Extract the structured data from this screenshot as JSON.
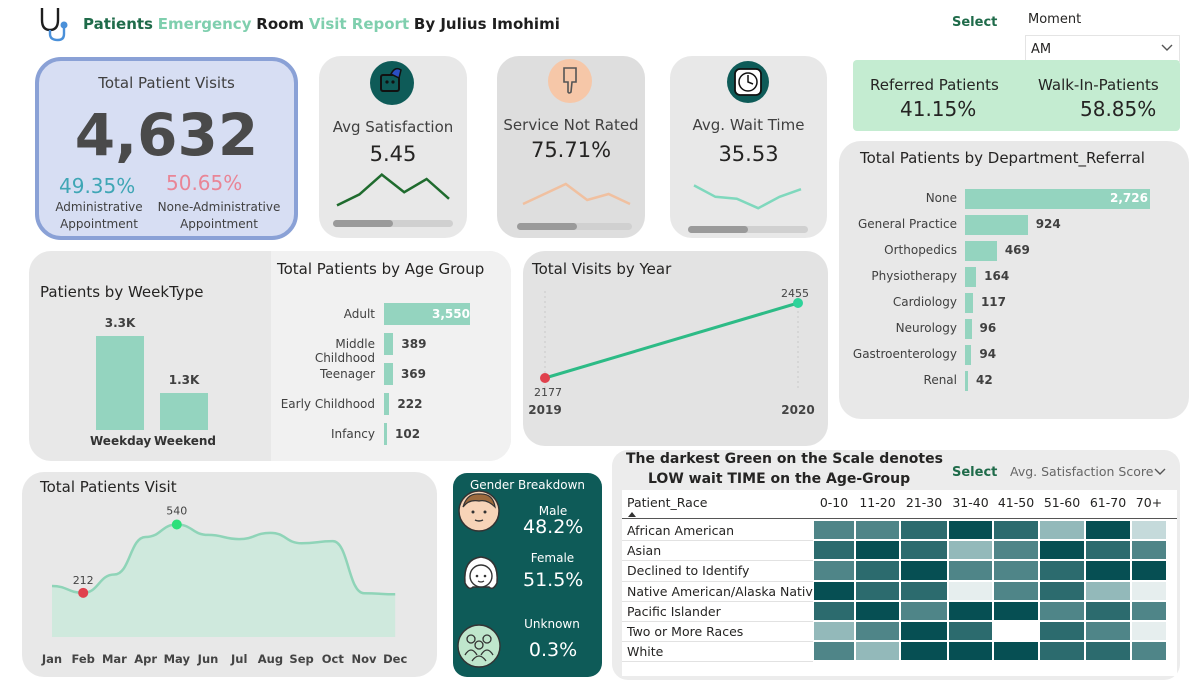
{
  "header": {
    "title_part1": "Patients",
    "title_part2": "Emergency",
    "title_part3": "Room",
    "title_part4": "Visit Report",
    "title_part5": "By Julius Imohimi",
    "select_label": "Select",
    "moment_label": "Moment",
    "moment_value": "AM"
  },
  "total_visits": {
    "title": "Total Patient Visits",
    "value": "4,632",
    "admin_pct": "49.35%",
    "admin_label_1": "Administrative",
    "admin_label_2": "Appointment",
    "nonadmin_pct": "50.65%",
    "nonadmin_label_1": "None-Administrative",
    "nonadmin_label_2": "Appointment"
  },
  "kpis": [
    {
      "title": "Avg Satisfaction",
      "value": "5.45",
      "icon": "satisfaction-icon",
      "trend": [
        0.15,
        0.4,
        0.85,
        0.45,
        0.75,
        0.3
      ],
      "color": "#1f6b2e",
      "scroll": 0.68
    },
    {
      "title": "Service Not Rated",
      "value": "75.71%",
      "icon": "thumb-icon",
      "trend": [
        0.2,
        0.45,
        0.7,
        0.3,
        0.45,
        0.2
      ],
      "color": "#f0c0a0",
      "scroll": 0.5
    },
    {
      "title": "Avg. Wait Time",
      "value": "35.53",
      "icon": "clock-icon",
      "trend": [
        0.7,
        0.4,
        0.35,
        0.1,
        0.4,
        0.6
      ],
      "color": "#7fd8bd",
      "scroll": 0.5
    }
  ],
  "referral": {
    "referred_label": "Referred Patients",
    "referred_value": "41.15%",
    "walkin_label": "Walk-In-Patients",
    "walkin_value": "58.85%"
  },
  "department": {
    "title": "Total Patients by Department_Referral",
    "rows": [
      {
        "label": "None",
        "value": 2726,
        "text": "2,726"
      },
      {
        "label": "General Practice",
        "value": 924,
        "text": "924"
      },
      {
        "label": "Orthopedics",
        "value": 469,
        "text": "469"
      },
      {
        "label": "Physiotherapy",
        "value": 164,
        "text": "164"
      },
      {
        "label": "Cardiology",
        "value": 117,
        "text": "117"
      },
      {
        "label": "Neurology",
        "value": 96,
        "text": "96"
      },
      {
        "label": "Gastroenterology",
        "value": 94,
        "text": "94"
      },
      {
        "label": "Renal",
        "value": 42,
        "text": "42"
      }
    ]
  },
  "weektype": {
    "title": "Patients by WeekType",
    "bars": [
      {
        "label": "Weekday",
        "value": 3.3,
        "text": "3.3K"
      },
      {
        "label": "Weekend",
        "value": 1.3,
        "text": "1.3K"
      }
    ]
  },
  "agegroup": {
    "title": "Total Patients by Age Group",
    "rows": [
      {
        "label": "Adult",
        "value": 3550,
        "text": "3,550"
      },
      {
        "label": "Middle Childhood",
        "value": 389,
        "text": "389"
      },
      {
        "label": "Teenager",
        "value": 369,
        "text": "369"
      },
      {
        "label": "Early Childhood",
        "value": 222,
        "text": "222"
      },
      {
        "label": "Infancy",
        "value": 102,
        "text": "102"
      }
    ]
  },
  "visits_year": {
    "title": "Total Visits by Year",
    "points": [
      {
        "year": "2019",
        "value": 2177,
        "text": "2177"
      },
      {
        "year": "2020",
        "value": 2455,
        "text": "2455"
      }
    ]
  },
  "monthly": {
    "title": "Total Patients Visit",
    "months": [
      "Jan",
      "Feb",
      "Mar",
      "Apr",
      "May",
      "Jun",
      "Jul",
      "Aug",
      "Sep",
      "Oct",
      "Nov",
      "Dec"
    ],
    "values": [
      245,
      212,
      300,
      480,
      540,
      490,
      470,
      500,
      450,
      460,
      210,
      205
    ],
    "min_label": "212",
    "max_label": "540"
  },
  "gender": {
    "title": "Gender Breakdown",
    "male_label": "Male",
    "male_value": "48.2%",
    "female_label": "Female",
    "female_value": "51.5%",
    "unknown_label": "Unknown",
    "unknown_value": "0.3%"
  },
  "heatmap": {
    "title_line1": "The darkest Green on the Scale denotes",
    "title_line2": "LOW wait TIME on the Age-Group",
    "select_label": "Select",
    "select_value": "Avg. Satisfaction Score",
    "row_header": "Patient_Race",
    "columns": [
      "0-10",
      "11-20",
      "21-30",
      "31-40",
      "41-50",
      "51-60",
      "61-70",
      "70+"
    ],
    "rows": [
      {
        "label": "African American",
        "cells": [
          3,
          3,
          4,
          5,
          4,
          2,
          5,
          0
        ]
      },
      {
        "label": "Asian",
        "cells": [
          4,
          5,
          4,
          2,
          3,
          5,
          4,
          3
        ]
      },
      {
        "label": "Declined to Identify",
        "cells": [
          3,
          4,
          5,
          3,
          3,
          4,
          5,
          5
        ]
      },
      {
        "label": "Native American/Alaska Native",
        "cells": [
          5,
          4,
          4,
          1,
          3,
          4,
          2,
          1
        ]
      },
      {
        "label": "Pacific Islander",
        "cells": [
          4,
          5,
          3,
          5,
          5,
          3,
          4,
          3
        ]
      },
      {
        "label": "Two or More Races",
        "cells": [
          2,
          3,
          5,
          4,
          -1,
          4,
          3,
          1
        ]
      },
      {
        "label": "White",
        "cells": [
          3,
          2,
          5,
          5,
          5,
          4,
          4,
          3
        ]
      }
    ]
  }
}
